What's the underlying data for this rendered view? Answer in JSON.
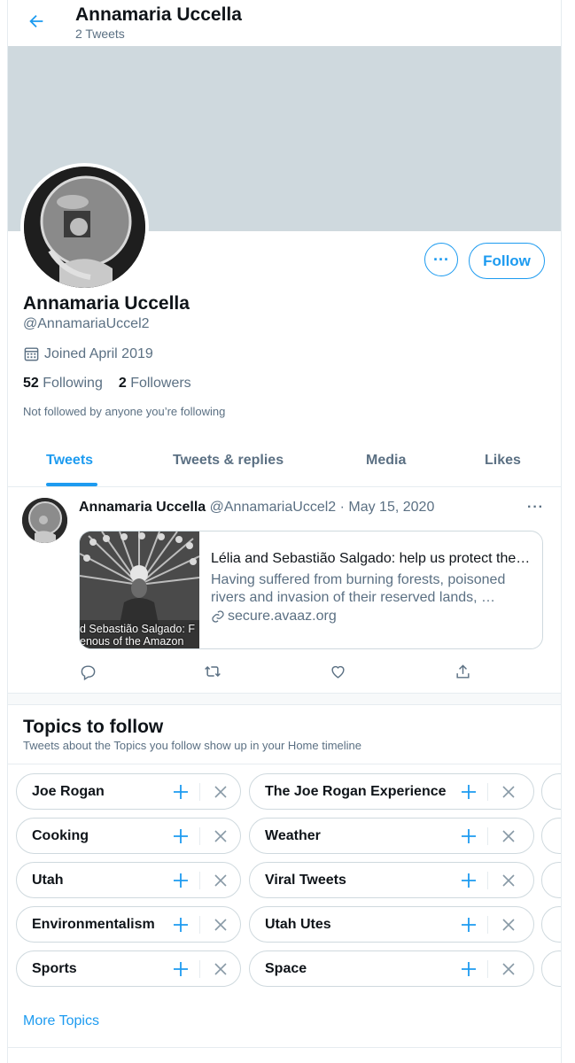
{
  "header": {
    "name": "Annamaria Uccella",
    "tweet_count": "2 Tweets"
  },
  "profile": {
    "name": "Annamaria Uccella",
    "handle": "@AnnamariaUccel2",
    "joined": "Joined April 2019",
    "following_count": "52",
    "following_label": "Following",
    "followers_count": "2",
    "followers_label": "Followers",
    "not_followed": "Not followed by anyone you’re following",
    "more_label": "···",
    "follow_label": "Follow"
  },
  "tabs": [
    {
      "label": "Tweets"
    },
    {
      "label": "Tweets & replies"
    },
    {
      "label": "Media"
    },
    {
      "label": "Likes"
    }
  ],
  "tweet": {
    "name": "Annamaria Uccella",
    "meta": "@AnnamariaUccel2 · May 15, 2020",
    "more": "···",
    "card": {
      "image_caption": "d Sebastião Salgado: F\nenous of the Amazon",
      "title": "Lélia and Sebastião Salgado: help us protect the Indigenous of the Amazon",
      "description": "Having suffered from burning forests, poisoned rivers and invasion of their reserved lands, …",
      "domain": "secure.avaaz.org"
    }
  },
  "topics": {
    "title": "Topics to follow",
    "subtitle": "Tweets about the Topics you follow show up in your Home timeline",
    "chips": [
      {
        "label": "Joe Rogan"
      },
      {
        "label": "The Joe Rogan Experience"
      },
      {
        "label": "Cooking"
      },
      {
        "label": "Weather"
      },
      {
        "label": "Utah"
      },
      {
        "label": "Viral Tweets"
      },
      {
        "label": "Environmentalism"
      },
      {
        "label": "Utah Utes"
      },
      {
        "label": "Sports"
      },
      {
        "label": "Space"
      }
    ],
    "more_label": "More Topics"
  },
  "colors": {
    "accent": "#1d9bf0",
    "muted": "#5b7083",
    "banner": "#cfd9de"
  }
}
